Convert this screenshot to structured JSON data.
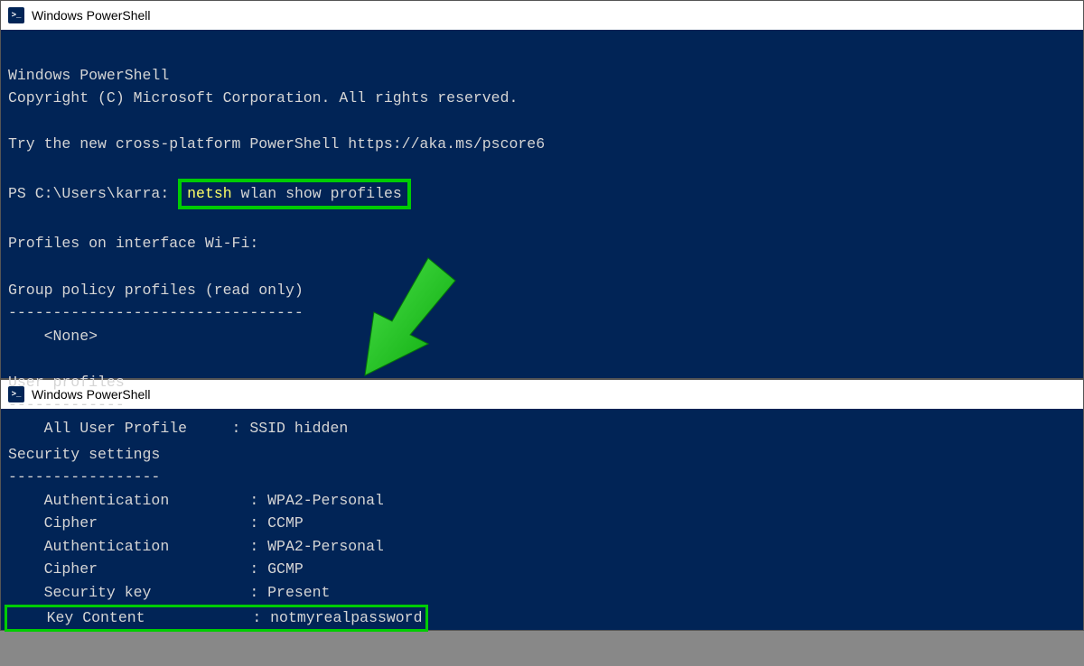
{
  "window1": {
    "title": "Windows PowerShell",
    "banner1": "Windows PowerShell",
    "banner2": "Copyright (C) Microsoft Corporation. All rights reserved.",
    "banner3": "Try the new cross-platform PowerShell https://aka.ms/pscore6",
    "prompt": "PS C:\\Users\\karra:",
    "cmd_netsh": "netsh",
    "cmd_rest": " wlan show profiles",
    "section_profiles": "Profiles on interface Wi-Fi:",
    "group_policy": "Group policy profiles (read only)",
    "divider1": "---------------------------------",
    "none": "    <None>",
    "user_profiles": "User profiles",
    "divider2": "-------------",
    "all_user": "    All User Profile     : SSID hidden"
  },
  "window2": {
    "title": "Windows PowerShell",
    "section": "Security settings",
    "divider": "-----------------",
    "auth1": "    Authentication         : WPA2-Personal",
    "cipher1": "    Cipher                 : CCMP",
    "auth2": "    Authentication         : WPA2-Personal",
    "cipher2": "    Cipher                 : GCMP",
    "seckey": "    Security key           : Present",
    "keycontent": "    Key Content            : notmyrealpassword"
  }
}
